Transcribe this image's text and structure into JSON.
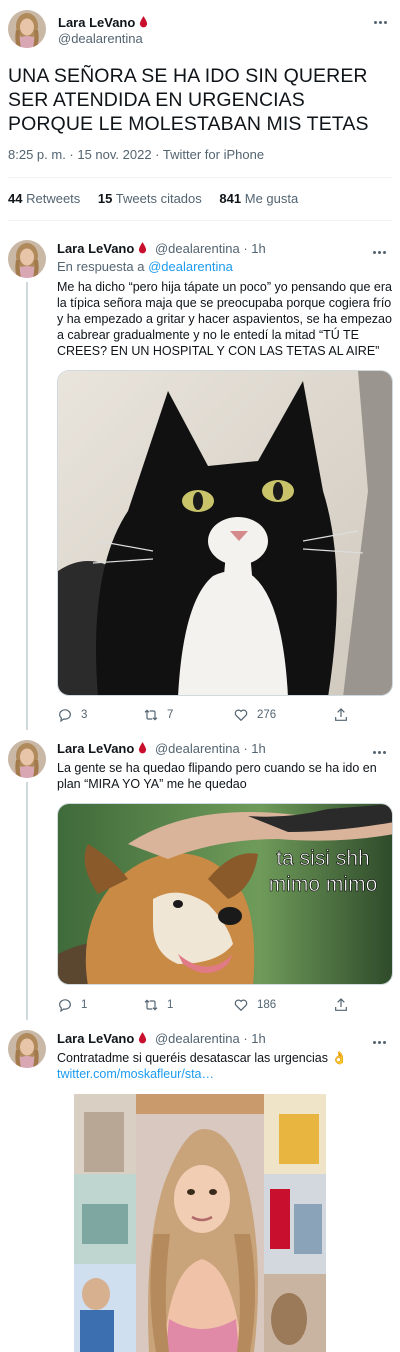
{
  "author": {
    "name": "Lara LeVano",
    "handle": "@dealarentina"
  },
  "main_tweet": {
    "text": "UNA SEÑORA SE HA IDO SIN QUERER SER ATENDIDA EN URGENCIAS PORQUE LE MOLESTABAN MIS TETAS",
    "meta": "8:25 p. m. · 15 nov. 2022 · Twitter for iPhone",
    "retweets_count": "44",
    "retweets_label": "Retweets",
    "quotes_count": "15",
    "quotes_label": "Tweets citados",
    "likes_count": "841",
    "likes_label": "Me gusta"
  },
  "replies": [
    {
      "time": "· 1h",
      "replying_prefix": "En respuesta a",
      "replying_handle": "@dealarentina",
      "text": "Me ha dicho “pero hija tápate un poco” yo pensando que era la típica señora maja que se preocupaba porque cogiera frío y ha empezado a gritar y hacer aspavientos, se ha empezao a cabrear gradualmente y no le entedí la mitad  “TÚ TE CREES? EN UN HOSPITAL Y CON LAS TETAS AL AIRE”",
      "media_icon": "black-white-cat-photo",
      "replies_count": "3",
      "retweets_count": "7",
      "likes_count": "276"
    },
    {
      "time": "· 1h",
      "text": "La gente se ha quedao flipando pero cuando se ha ido en plan “MIRA YO YA” me he quedao",
      "media_icon": "dog-meme-photo",
      "meme_text_line1": "ta sisi shh",
      "meme_text_line2": "mimo mimo",
      "replies_count": "1",
      "retweets_count": "1",
      "likes_count": "186"
    },
    {
      "time": "· 1h",
      "text": "Contratadme si queréis desatascar las urgencias",
      "emoji": "👌",
      "link": "twitter.com/moskafleur/sta…",
      "media_icon": "collage-photo"
    }
  ],
  "colors": {
    "accent": "#1d9bf0",
    "secondary_text": "#536471",
    "blood_drop": "#c8102e"
  }
}
